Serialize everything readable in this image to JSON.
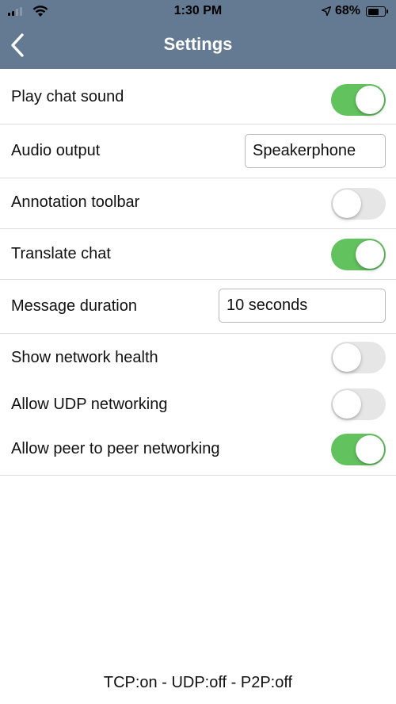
{
  "status_bar": {
    "time": "1:30 PM",
    "battery_percent": "68%",
    "battery_level": 0.68,
    "icons": [
      "signal-icon",
      "wifi-icon",
      "location-arrow-icon",
      "battery-icon"
    ]
  },
  "nav": {
    "title": "Settings",
    "back_icon": "chevron-left-icon",
    "background_color": "#647a92"
  },
  "settings": {
    "play_chat_sound": {
      "label": "Play chat sound",
      "on": true
    },
    "audio_output": {
      "label": "Audio output",
      "value": "Speakerphone"
    },
    "annotation_toolbar": {
      "label": "Annotation toolbar",
      "on": false
    },
    "translate_chat": {
      "label": "Translate chat",
      "on": true
    },
    "message_duration": {
      "label": "Message duration",
      "value": "10 seconds"
    },
    "show_network_health": {
      "label": "Show network health",
      "on": false
    },
    "allow_udp": {
      "label": "Allow UDP networking",
      "on": false
    },
    "allow_p2p": {
      "label": "Allow peer to peer networking",
      "on": true
    }
  },
  "colors": {
    "toggle_on": "#62c25e",
    "toggle_off": "#e6e6e6"
  },
  "footer": {
    "status": "TCP:on - UDP:off - P2P:off"
  }
}
